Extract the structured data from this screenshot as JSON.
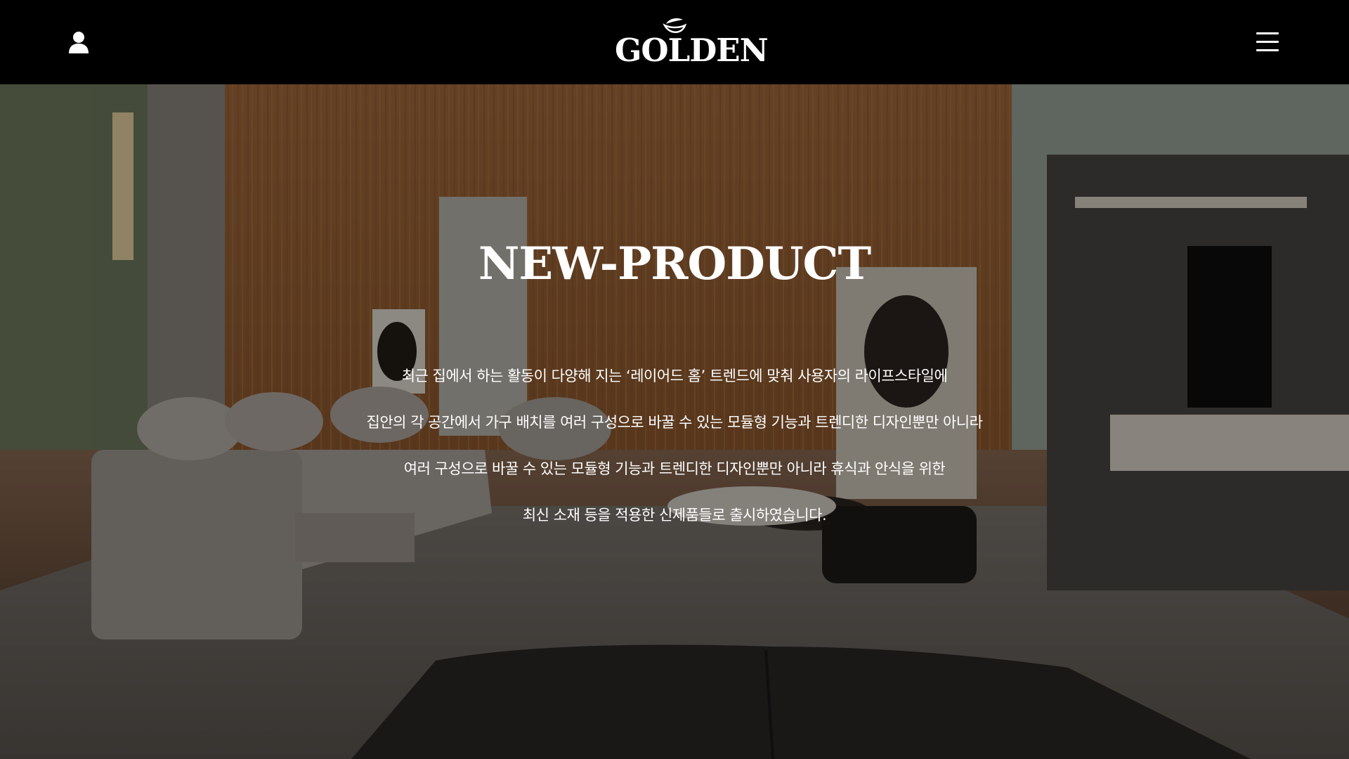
{
  "header": {
    "logo_text": "GOLDEN",
    "user_icon": "user-icon",
    "menu_icon": "hamburger-menu-icon",
    "background": "#000000"
  },
  "hero": {
    "title": "NEW-PRODUCT",
    "description": [
      "최근 집에서 하는 활동이 다양해 지는 ‘레이어드 홈’ 트렌드에 맞춰 사용자의 라이프스타일에",
      "집안의 각 공간에서 가구 배치를 여러 구성으로 바꿀 수 있는 모듈형 기능과 트렌디한 디자인뿐만 아니라",
      "여러 구성으로 바꿀 수 있는 모듈형 기능과 트렌디한 디자인뿐만 아니라 휴식과 안식을 위한",
      "최신 소재 등을 적용한 신제품들로 출시하였습니다."
    ]
  }
}
